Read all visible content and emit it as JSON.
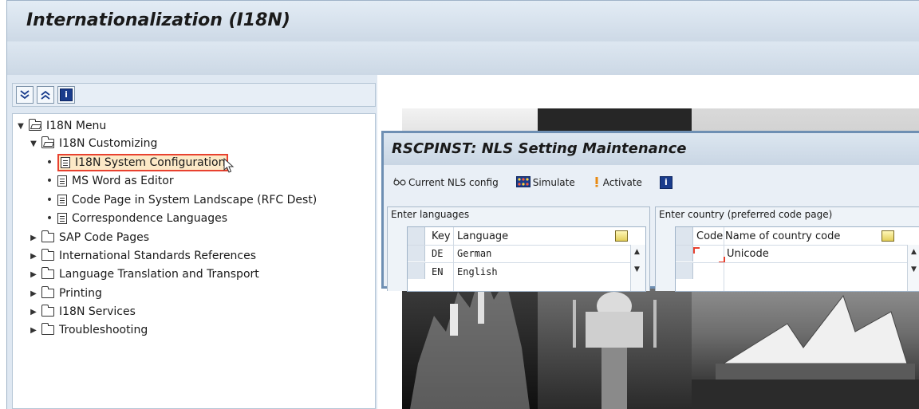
{
  "window": {
    "title": "Internationalization (I18N)"
  },
  "tree_toolbar": {
    "expand_icon": "expand-all-icon",
    "collapse_icon": "collapse-all-icon",
    "info_icon": "info-icon"
  },
  "tree": {
    "root_label": "I18N Menu",
    "customizing_label": "I18N Customizing",
    "customizing_items": [
      "I18N System Configuration",
      "MS Word as Editor",
      "Code Page in System Landscape (RFC Dest)",
      "Correspondence Languages"
    ],
    "folders": [
      "SAP Code Pages",
      "International Standards References",
      "Language Translation and Transport",
      "Printing",
      "I18N Services",
      "Troubleshooting"
    ]
  },
  "dialog": {
    "title": "RSCPINST: NLS Setting Maintenance",
    "toolbar": {
      "current_nls_config": "Current NLS config",
      "simulate": "Simulate",
      "activate": "Activate"
    },
    "languages_group": {
      "title": "Enter languages",
      "col_key": "Key",
      "col_language": "Language",
      "rows": [
        {
          "key": "DE",
          "language": "German"
        },
        {
          "key": "EN",
          "language": "English"
        }
      ]
    },
    "country_group": {
      "title": "Enter country (preferred code page)",
      "col_code": "Code",
      "col_name": "Name of country code",
      "rows": [
        {
          "code": "",
          "name": "Unicode"
        }
      ]
    }
  },
  "colors": {
    "accent_blue": "#6e8fb3",
    "selection_border": "#e8412f",
    "selection_fill": "#fce9c7"
  }
}
